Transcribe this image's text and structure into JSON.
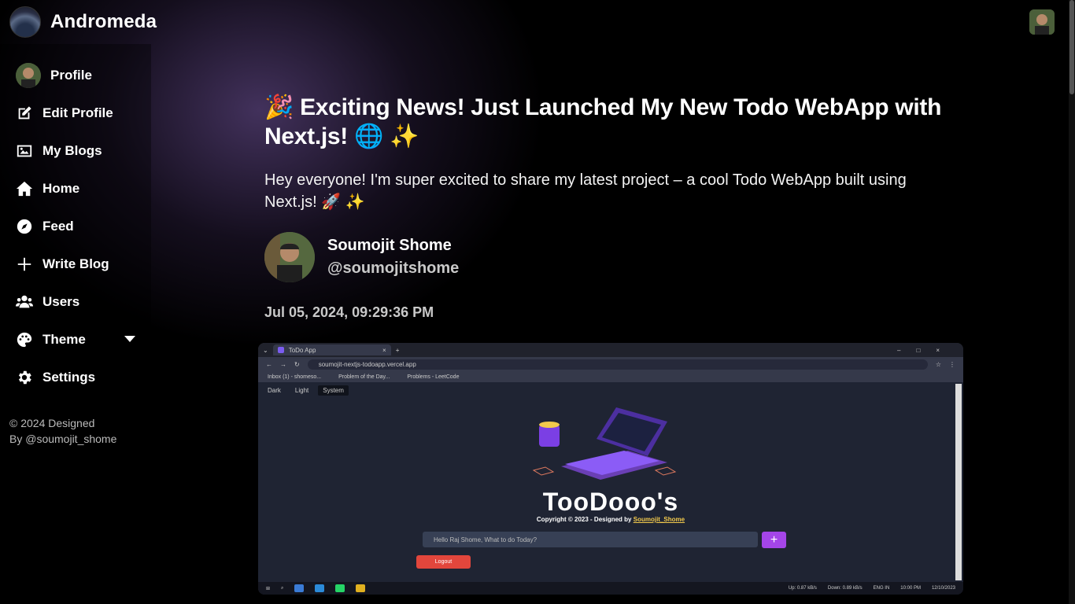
{
  "app": {
    "title": "Andromeda"
  },
  "sidebar": {
    "items": [
      {
        "label": "Profile"
      },
      {
        "label": "Edit Profile"
      },
      {
        "label": "My Blogs"
      },
      {
        "label": "Home"
      },
      {
        "label": "Feed"
      },
      {
        "label": "Write Blog"
      },
      {
        "label": "Users"
      },
      {
        "label": "Theme"
      },
      {
        "label": "Settings"
      }
    ],
    "footer_line1": "© 2024 Designed",
    "footer_line2": "By @soumojit_shome"
  },
  "post": {
    "title": "🎉 Exciting News! Just Launched My New Todo WebApp with Next.js! 🌐 ✨",
    "body": "Hey everyone! I'm super excited to share my latest project – a cool Todo WebApp built using Next.js! 🚀 ✨",
    "author_name": "Soumojit Shome",
    "author_handle": "@soumojitshome",
    "date": "Jul 05, 2024, 09:29:36 PM"
  },
  "screenshot": {
    "tab_title": "ToDo App",
    "url": "soumojit-nextjs-todoapp.vercel.app",
    "bookmarks": [
      "Inbox (1) - shomeso...",
      "Problem of the Day...",
      "Problems - LeetCode"
    ],
    "theme_options": [
      "Dark",
      "Light",
      "System"
    ],
    "app_title": "TooDooo's",
    "copyright": "Copyright © 2023 - Designed by",
    "copyright_author": "Soumojit_Shome",
    "input_placeholder": "Hello Raj Shome, What to do Today?",
    "add_label": "+",
    "logout_label": "Logout",
    "taskbar_speed_up": "Up: 0.87 kB/s",
    "taskbar_speed_down": "Down: 0.89 kB/s",
    "taskbar_lang": "ENG IN",
    "taskbar_time": "10:00 PM",
    "taskbar_date": "12/10/2023"
  }
}
